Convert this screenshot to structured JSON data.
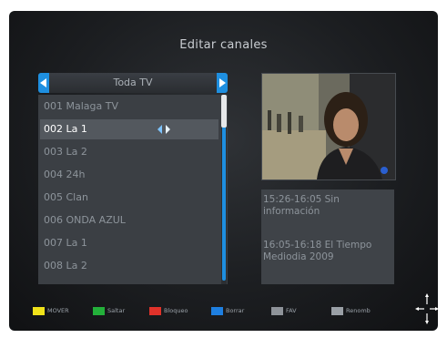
{
  "screen_title": "Editar canales",
  "list": {
    "header_label": "Toda TV",
    "channels": [
      "001 Malaga TV",
      "002 La 1",
      "003 La 2",
      "004 24h",
      "005 Clan",
      "006 ONDA AZUL",
      "007 La 1",
      "008 La 2"
    ],
    "selected_index": 1
  },
  "info": {
    "event1": "15:26-16:05  Sin información",
    "event2": "16:05-16:18  El Tiempo Mediodia 2009"
  },
  "footer": {
    "items": [
      {
        "label": "MOVER",
        "color": "#f0e21a"
      },
      {
        "label": "Saltar",
        "color": "#23b03a"
      },
      {
        "label": "Bloqueo",
        "color": "#e0322a"
      },
      {
        "label": "Borrar",
        "color": "#1e7fe0"
      },
      {
        "label": "FAV",
        "icon": "fav-key-icon"
      },
      {
        "label": "Renomb",
        "icon": "rename-key-icon"
      }
    ]
  },
  "colors": {
    "accent": "#1e8fe0",
    "panel": "#3b3f44",
    "selected_row": "#53585e"
  }
}
